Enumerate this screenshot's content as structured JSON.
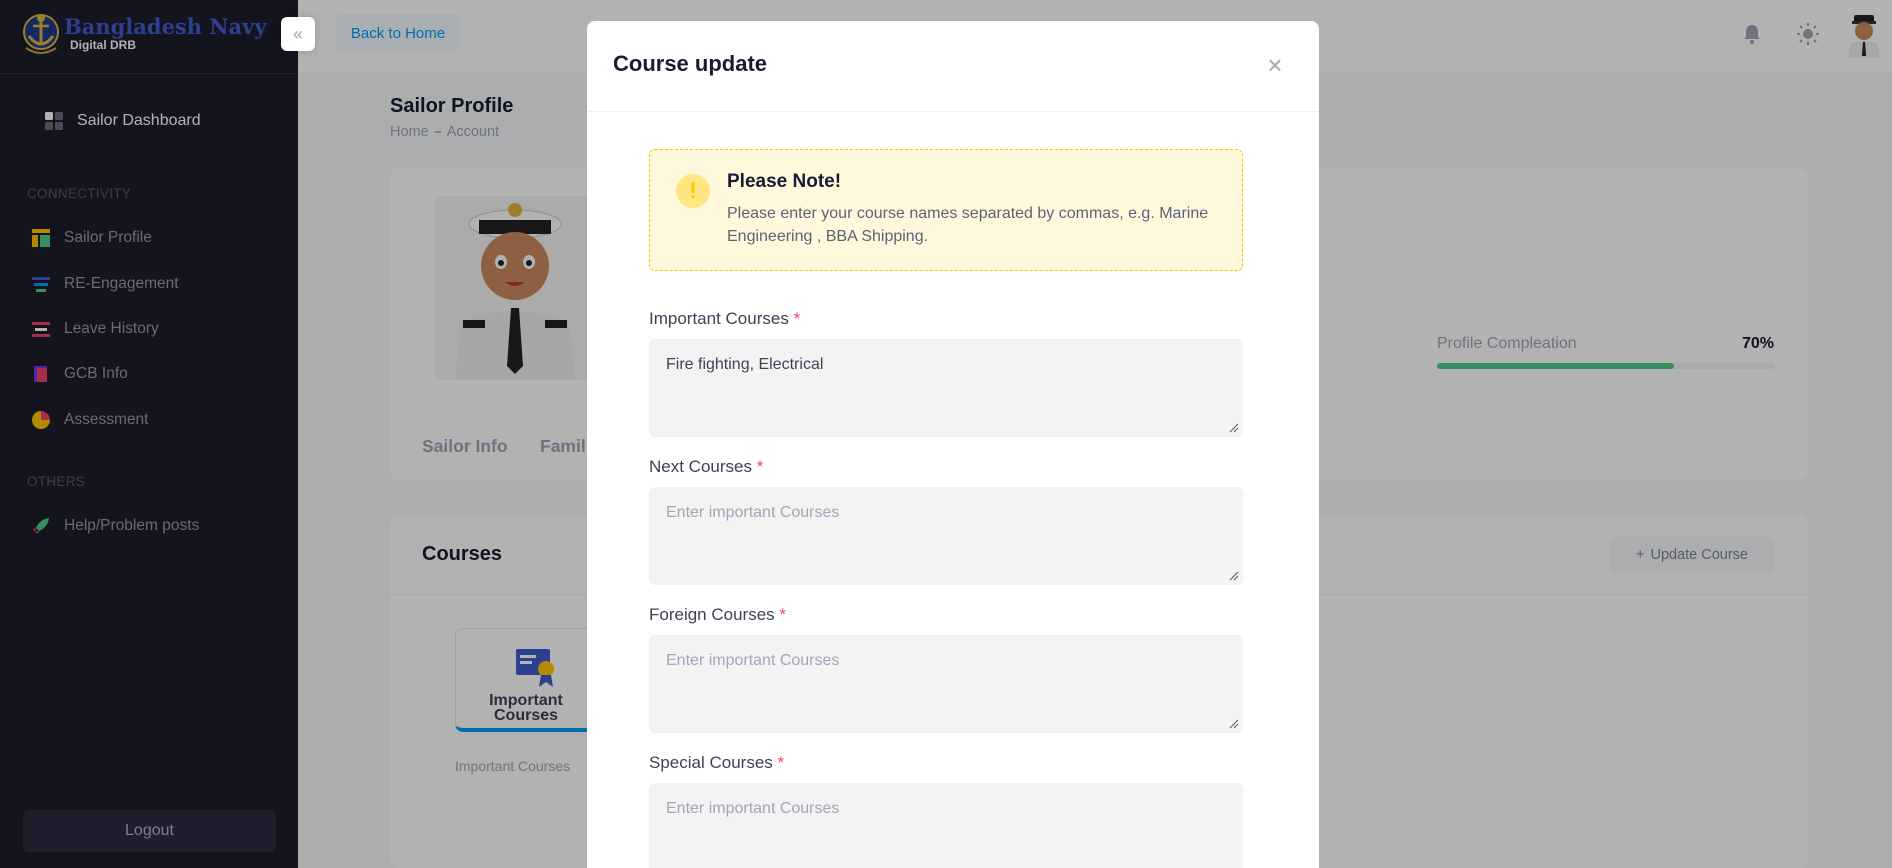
{
  "brand": {
    "title": "Bangladesh Navy",
    "subtitle": "Digital DRB"
  },
  "sidebar": {
    "dashboard_label": "Sailor Dashboard",
    "section_connectivity": "CONNECTIVITY",
    "items": [
      {
        "label": "Sailor Profile",
        "icon": "profile-icon"
      },
      {
        "label": "RE-Engagement",
        "icon": "re-engagement-icon"
      },
      {
        "label": "Leave History",
        "icon": "leave-history-icon"
      },
      {
        "label": "GCB Info",
        "icon": "gcb-info-icon"
      },
      {
        "label": "Assessment",
        "icon": "assessment-icon"
      }
    ],
    "section_others": "OTHERS",
    "others_items": [
      {
        "label": "Help/Problem posts",
        "icon": "rocket-icon"
      }
    ],
    "logout_label": "Logout"
  },
  "header": {
    "back_label": "Back to Home"
  },
  "page": {
    "title": "Sailor Profile",
    "breadcrumb": [
      "Home",
      "Account"
    ],
    "tabs": [
      "Sailor Info",
      "Famil"
    ],
    "profile_completion_label": "Profile Compleation",
    "profile_completion_value": "70%",
    "profile_completion_fraction": 0.7
  },
  "courses": {
    "title": "Courses",
    "update_button": "Update Course",
    "card_label": "Important Courses",
    "card_sub": "Important Courses"
  },
  "modal": {
    "title": "Course update",
    "notice_title": "Please Note!",
    "notice_text": "Please enter your course names separated by commas, e.g. Marine Engineering , BBA Shipping.",
    "fields": [
      {
        "label": "Important Courses",
        "value": "Fire fighting, Electrical",
        "placeholder": ""
      },
      {
        "label": "Next Courses",
        "value": "",
        "placeholder": "Enter important Courses"
      },
      {
        "label": "Foreign Courses",
        "value": "",
        "placeholder": "Enter important Courses"
      },
      {
        "label": "Special Courses",
        "value": "",
        "placeholder": "Enter important Courses"
      }
    ],
    "required_mark": "*"
  },
  "colors": {
    "sidebar_bg": "#1e1e2d",
    "accent": "#009ef7",
    "success": "#50cd89",
    "danger": "#f1416c",
    "warning": "#ffc700"
  }
}
